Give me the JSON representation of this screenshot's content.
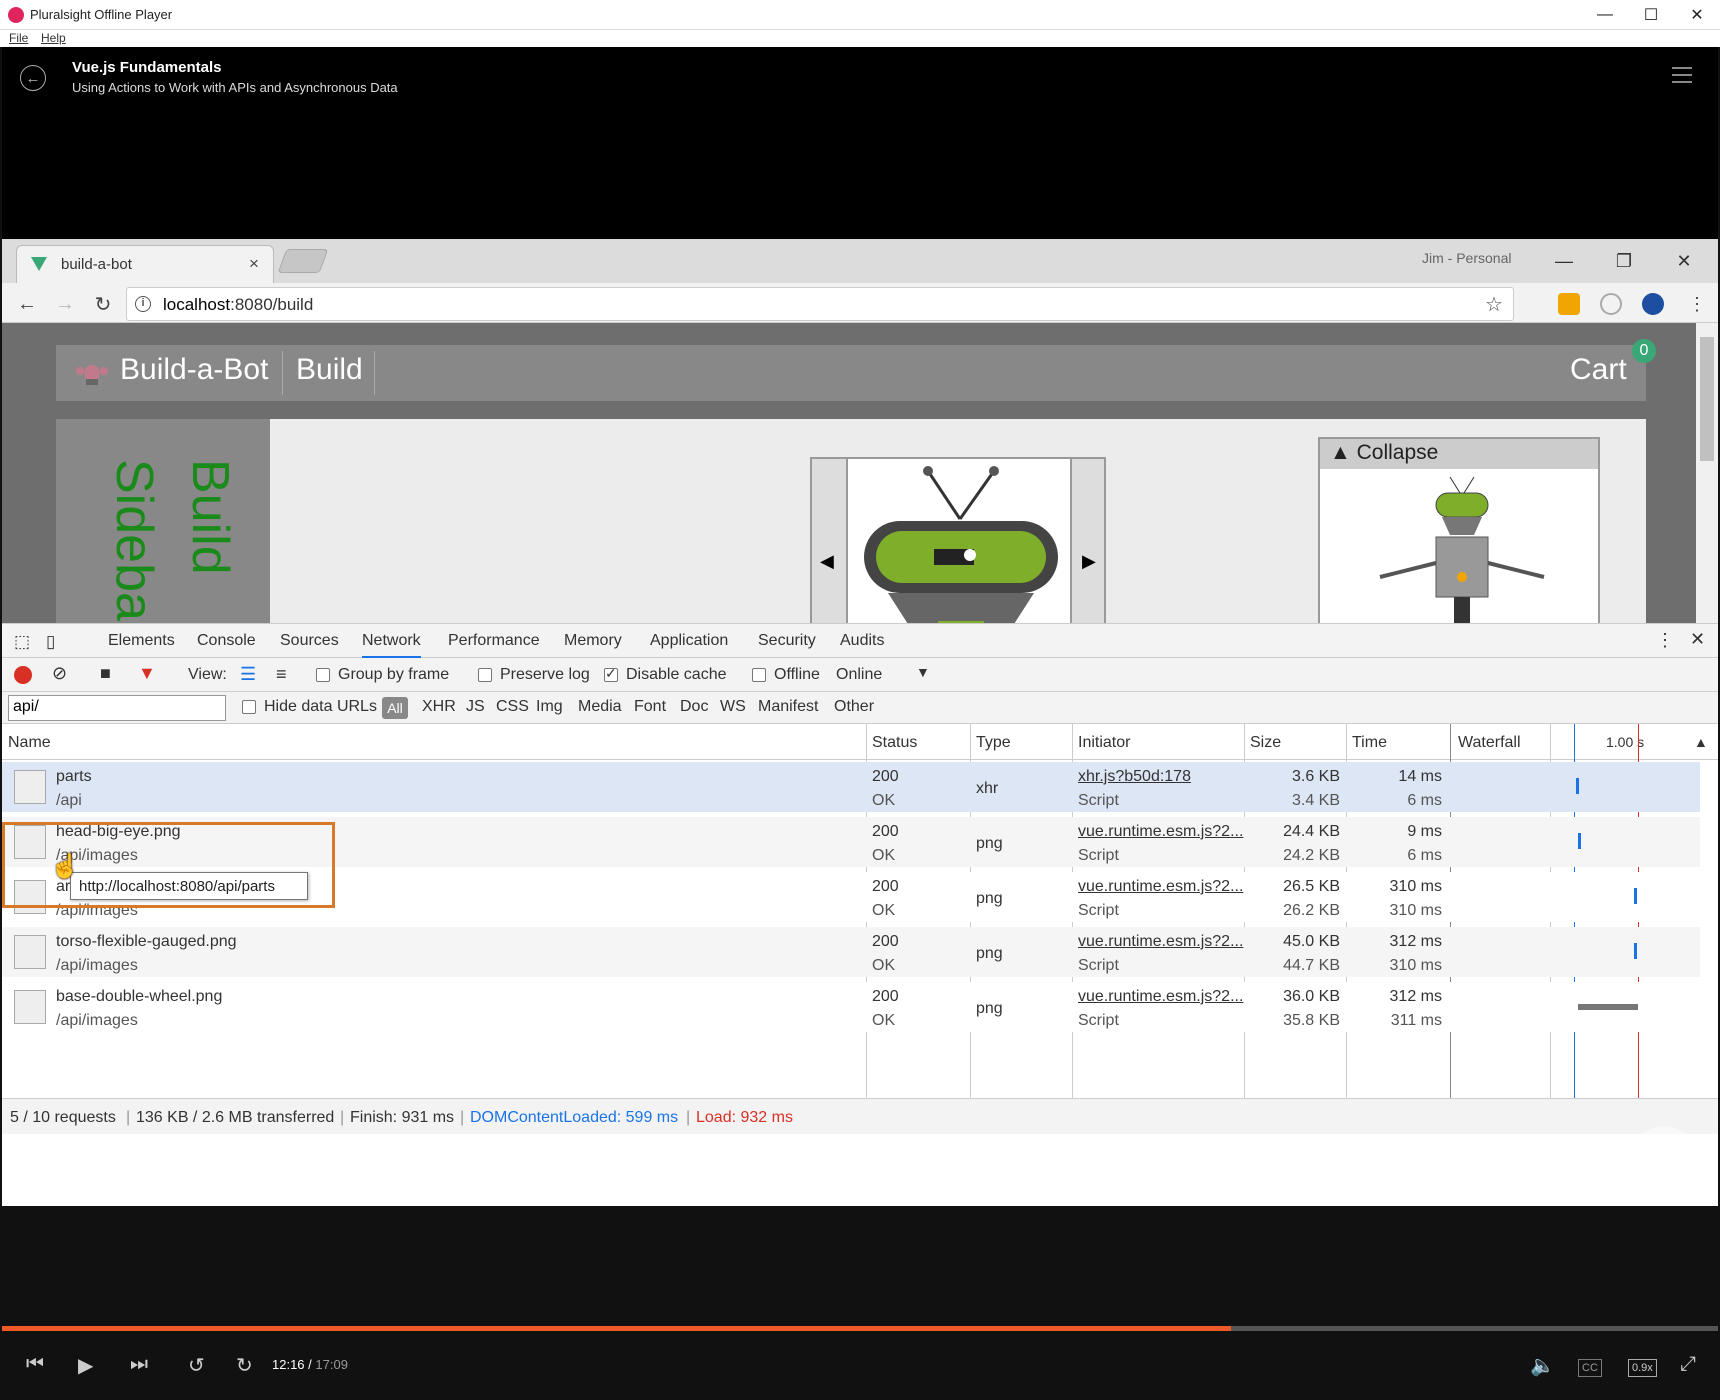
{
  "app": {
    "title": "Pluralsight Offline Player",
    "menu": [
      "File",
      "Help"
    ],
    "window_controls": {
      "minimize": "—",
      "maximize": "☐",
      "close": "✕"
    }
  },
  "course": {
    "title": "Vue.js Fundamentals",
    "subtitle": "Using Actions to Work with APIs and Asynchronous Data"
  },
  "browser": {
    "tab_title": "build-a-bot",
    "tab_close": "×",
    "profile": "Jim - Personal",
    "url_host": "localhost",
    "url_rest": ":8080/build",
    "window_controls": {
      "minimize": "—",
      "restore": "❐",
      "close": "✕"
    }
  },
  "site": {
    "brand": "Build-a-Bot",
    "nav_build": "Build",
    "cart_label": "Cart",
    "cart_count": "0",
    "sidebar_text": "Build Sidebar",
    "collapse_label": "▲ Collapse",
    "arrow_left": "◀",
    "arrow_right": "▶"
  },
  "devtools": {
    "tabs": [
      "Elements",
      "Console",
      "Sources",
      "Network",
      "Performance",
      "Memory",
      "Application",
      "Security",
      "Audits"
    ],
    "active_tab": "Network",
    "controls": {
      "view_label": "View:",
      "group_by_frame": "Group by frame",
      "preserve_log": "Preserve log",
      "disable_cache": "Disable cache",
      "offline": "Offline",
      "throttle": "Online",
      "disable_cache_checked": true
    },
    "filter": {
      "value": "api/",
      "hide_data_urls": "Hide data URLs",
      "types": [
        "All",
        "XHR",
        "JS",
        "CSS",
        "Img",
        "Media",
        "Font",
        "Doc",
        "WS",
        "Manifest",
        "Other"
      ]
    },
    "columns": [
      "Name",
      "Status",
      "Type",
      "Initiator",
      "Size",
      "Time",
      "Waterfall"
    ],
    "waterfall_scale": "1.00 s",
    "rows": [
      {
        "name": "parts",
        "path": "/api",
        "status": "200",
        "status_text": "OK",
        "type": "xhr",
        "initiator": "xhr.js?b50d:178",
        "initiator_type": "Script",
        "size": "3.6 KB",
        "size2": "3.4 KB",
        "time": "14 ms",
        "time2": "6 ms",
        "selected": true
      },
      {
        "name": "head-big-eye.png",
        "path": "/api/images",
        "status": "200",
        "status_text": "OK",
        "type": "png",
        "initiator": "vue.runtime.esm.js?2...",
        "initiator_type": "Script",
        "size": "24.4 KB",
        "size2": "24.2 KB",
        "time": "9 ms",
        "time2": "6 ms"
      },
      {
        "name": "arm-articulated-claw.png",
        "path": "/api/images",
        "status": "200",
        "status_text": "OK",
        "type": "png",
        "initiator": "vue.runtime.esm.js?2...",
        "initiator_type": "Script",
        "size": "26.5 KB",
        "size2": "26.2 KB",
        "time": "310 ms",
        "time2": "310 ms"
      },
      {
        "name": "torso-flexible-gauged.png",
        "path": "/api/images",
        "status": "200",
        "status_text": "OK",
        "type": "png",
        "initiator": "vue.runtime.esm.js?2...",
        "initiator_type": "Script",
        "size": "45.0 KB",
        "size2": "44.7 KB",
        "time": "312 ms",
        "time2": "310 ms"
      },
      {
        "name": "base-double-wheel.png",
        "path": "/api/images",
        "status": "200",
        "status_text": "OK",
        "type": "png",
        "initiator": "vue.runtime.esm.js?2...",
        "initiator_type": "Script",
        "size": "36.0 KB",
        "size2": "35.8 KB",
        "time": "312 ms",
        "time2": "311 ms"
      }
    ],
    "tooltip": "http://localhost:8080/api/parts",
    "status_bar": {
      "requests": "5 / 10 requests",
      "transferred": "136 KB / 2.6 MB transferred",
      "finish": "Finish: 931 ms",
      "dom_content_loaded": "DOMContentLoaded: 599 ms",
      "load": "Load: 932 ms"
    },
    "colors": {
      "dcl": "#1a73e8",
      "load": "#d93025",
      "record": "#d93025",
      "filter": "#d93025"
    }
  },
  "player": {
    "current_time": "12:16",
    "duration": "17:09",
    "progress": 0.716,
    "speed": "0.9x",
    "cc": "CC",
    "accent": "#f05a28"
  }
}
